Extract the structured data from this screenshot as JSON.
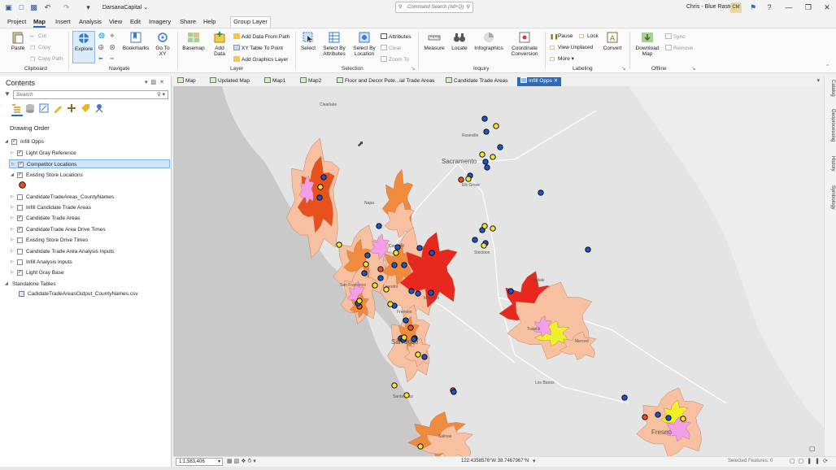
{
  "titlebar": {
    "project_name": "DarsanaCapital ⌄",
    "search_placeholder": "Command Search (Alt+Q)",
    "user": "Chris - Blue Raster",
    "avatar_initials": "CM"
  },
  "menu": {
    "tabs": [
      {
        "label": "Project"
      },
      {
        "label": "Map"
      },
      {
        "label": "Insert"
      },
      {
        "label": "Analysis"
      },
      {
        "label": "View"
      },
      {
        "label": "Edit"
      },
      {
        "label": "Imagery"
      },
      {
        "label": "Share"
      },
      {
        "label": "Help"
      }
    ],
    "active": "Map",
    "context_tab": "Group Layer"
  },
  "ribbon": {
    "clipboard": {
      "label": "Clipboard",
      "paste": "Paste",
      "cut": "Cut",
      "copy": "Copy",
      "copy_path": "Copy Path"
    },
    "navigate": {
      "label": "Navigate",
      "explore": "Explore",
      "bookmarks": "Bookmarks",
      "go_to_xy": "Go To XY"
    },
    "layer": {
      "label": "Layer",
      "basemap": "Basemap",
      "add_data": "Add Data",
      "add_data_from_path": "Add Data From Path",
      "xy_table": "XY Table To Point",
      "add_graphics": "Add Graphics Layer"
    },
    "selection": {
      "label": "Selection",
      "select": "Select",
      "select_by_attributes": "Select By Attributes",
      "select_by_location": "Select By Location",
      "attributes": "Attributes",
      "clear": "Clear",
      "zoom_to": "Zoom To"
    },
    "inquiry": {
      "label": "Inquiry",
      "measure": "Measure",
      "locate": "Locate",
      "infographics": "Infographics",
      "coordinate_conversion": "Coordinate Conversion"
    },
    "labeling": {
      "label": "Labeling",
      "pause": "Pause",
      "lock": "Lock",
      "view_unplaced": "View Unplaced",
      "more": "More",
      "convert": "Convert"
    },
    "offline": {
      "label": "Offline",
      "download_map": "Download Map",
      "sync": "Sync",
      "remove": "Remove"
    }
  },
  "contents": {
    "title": "Contents",
    "search_placeholder": "Search",
    "drawing_order": "Drawing Order",
    "rows": [
      {
        "label": "Infill Opps",
        "checked": true,
        "expanded": true,
        "indent": 0,
        "selected": false
      },
      {
        "label": "Light Gray Reference",
        "checked": true,
        "expanded": false,
        "indent": 1,
        "selected": false
      },
      {
        "label": "Competitor Locations",
        "checked": true,
        "expanded": false,
        "indent": 1,
        "selected": true
      },
      {
        "label": "Existing Store Locations",
        "checked": true,
        "expanded": true,
        "indent": 1,
        "selected": false
      },
      {
        "label": "",
        "checked": null,
        "expanded": false,
        "indent": 2,
        "selected": false,
        "symbol": "#e8501e"
      },
      {
        "label": "CandidateTradeAreas_CountyNames",
        "checked": false,
        "expanded": false,
        "indent": 1,
        "selected": false
      },
      {
        "label": "Infill Candidate Trade Areas",
        "checked": false,
        "expanded": false,
        "indent": 1,
        "selected": false
      },
      {
        "label": "Candidate Trade Areas",
        "checked": true,
        "expanded": false,
        "indent": 1,
        "selected": false
      },
      {
        "label": "CandidateTrade Area Drive Times",
        "checked": true,
        "expanded": false,
        "indent": 1,
        "selected": false
      },
      {
        "label": "Existing Store Drive Times",
        "checked": false,
        "expanded": false,
        "indent": 1,
        "selected": false
      },
      {
        "label": "Candidate Trade Area Analysis Inputs",
        "checked": false,
        "expanded": false,
        "indent": 1,
        "selected": false
      },
      {
        "label": "Infill Analysis Inputs",
        "checked": false,
        "expanded": false,
        "indent": 1,
        "selected": false
      },
      {
        "label": "Light Gray Base",
        "checked": true,
        "expanded": false,
        "indent": 1,
        "selected": false
      },
      {
        "label": "Standalone Tables",
        "checked": null,
        "expanded": true,
        "indent": 0,
        "selected": false
      },
      {
        "label": "CadidateTradeAreasOutput_CountyNames.csv",
        "checked": null,
        "expanded": false,
        "indent": 1,
        "selected": false,
        "table": true
      }
    ]
  },
  "doc_tabs": [
    {
      "label": "Map",
      "active": false
    },
    {
      "label": "Updated Map",
      "active": false
    },
    {
      "label": "Map1",
      "active": false
    },
    {
      "label": "Map2",
      "active": false
    },
    {
      "label": "Floor and Decor Pote...ial Trade Areas",
      "active": false
    },
    {
      "label": "Candidate Trade Areas",
      "active": false
    },
    {
      "label": "Infill Opps",
      "active": true
    }
  ],
  "map": {
    "place_labels": [
      "Clearlake",
      "Sacramento",
      "Roseville",
      "Elk Grove",
      "Napa",
      "Concord",
      "Stockton",
      "San Francisco",
      "Leandro",
      "Fremont",
      "Modesto",
      "San Jose",
      "Oakdale",
      "Turlock",
      "Merced",
      "Los Banos",
      "Santa Cruz",
      "Fresno",
      "Salinas"
    ],
    "colors": {
      "drive_time_light": "#f7c0a0",
      "drive_time_mid": "#f08a3c",
      "drive_time_dark": "#e8501e",
      "drive_time_red": "#e8281e",
      "pink": "#f29ee8",
      "yellow": "#eef02a",
      "water": "#c9c9c9",
      "land": "#e4e4e4",
      "competitor": "#1a56c8",
      "existing_store": "#e8501e",
      "candidate": "#f5e22a"
    }
  },
  "side_tabs": [
    "Catalog",
    "Geoprocessing",
    "History",
    "Symbology"
  ],
  "status": {
    "scale": "1:1,583,406",
    "coordinates": "122.4358576°W 38.7467967°N",
    "selected_features": "Selected Features: 0"
  }
}
